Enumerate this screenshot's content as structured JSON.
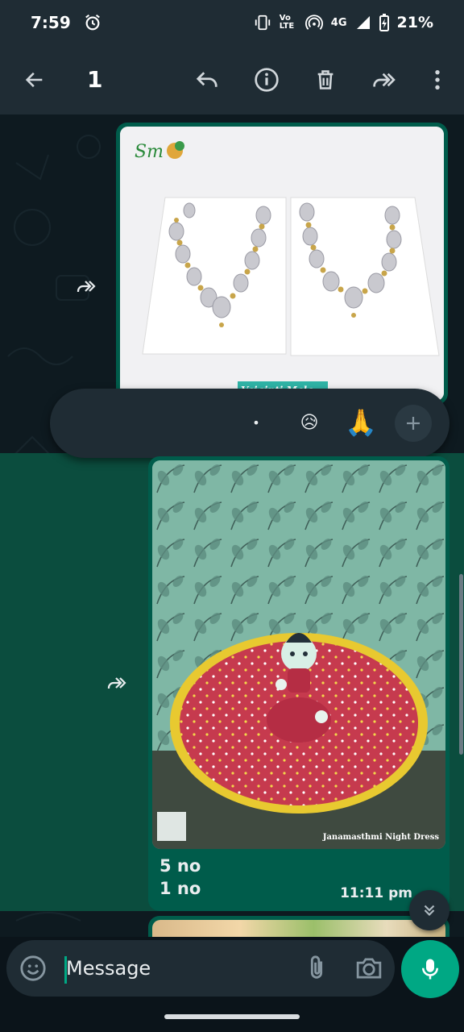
{
  "status_bar": {
    "time": "7:59",
    "network": "4G",
    "volte": "Vo LTE",
    "battery": "21%"
  },
  "action_bar": {
    "selected_count": "1",
    "icons": [
      "back-arrow-icon",
      "reply-icon",
      "info-icon",
      "delete-icon",
      "forward-icon",
      "more-vertical-icon"
    ]
  },
  "messages": [
    {
      "image_banner": "Vaiginti Mala"
    },
    {
      "image_watermark": "Janamasthmi Night Dress",
      "caption_line1": "5 no",
      "caption_line2": "1 no",
      "time": "11:11 pm"
    }
  ],
  "reactions": [
    "•",
    "😥",
    "🙏"
  ],
  "composer": {
    "placeholder": "Message"
  },
  "colors": {
    "accent": "#00a884",
    "outgoing_bubble": "#005c4b",
    "bar_bg": "#1f2c34",
    "selected_highlight": "#0b4d3e"
  }
}
